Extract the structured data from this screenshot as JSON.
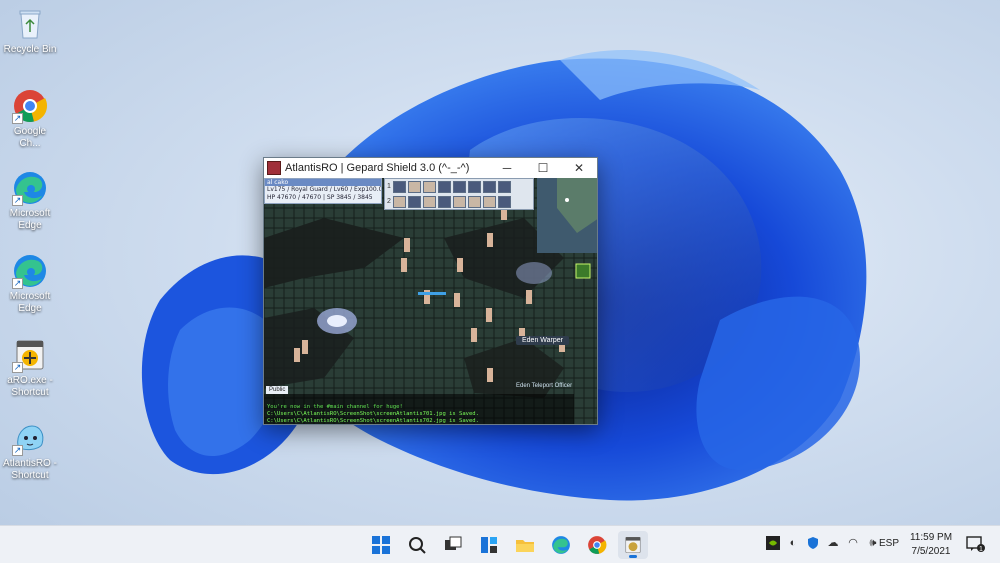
{
  "desktop": {
    "icons": [
      {
        "label": "Recycle Bin",
        "icon": "recycle-bin-icon"
      },
      {
        "label": "Google Ch...",
        "icon": "chrome-icon"
      },
      {
        "label": "Microsoft Edge",
        "icon": "edge-icon"
      },
      {
        "label": "Microsoft Edge",
        "icon": "edge-icon"
      },
      {
        "label": "aRO.exe - Shortcut",
        "icon": "game-exe-icon"
      },
      {
        "label": "AtlantisRO - Shortcut",
        "icon": "atlantisro-icon"
      }
    ]
  },
  "game_window": {
    "title": "AtlantisRO | Gepard Shield 3.0 (^-_-^)",
    "char": {
      "name": "al cako",
      "line1": "Lv175 / Royal Guard / Lv60 / Exp100.0%",
      "line2": "HP 47670 / 47670 | SP 3845 / 3845"
    },
    "hotkey_rows": [
      "1",
      "2"
    ],
    "npc_label": "Eden Warper",
    "npc_label2": "Eden Teleport Officer",
    "chat": {
      "tab": "Public",
      "lines": [
        "You're now in the #main channel for huge!",
        "C:\\Users\\C\\AtlantisRO\\ScreenShot\\screenAtlantis701.jpg is Saved.",
        "C:\\Users\\C\\AtlantisRO\\ScreenShot\\screenAtlantis702.jpg is Saved."
      ]
    }
  },
  "taskbar": {
    "apps": [
      "start-icon",
      "search-icon",
      "task-view-icon",
      "widgets-icon",
      "file-explorer-icon",
      "edge-icon",
      "chrome-icon",
      "game-app-icon"
    ],
    "language": "ESP",
    "time": "11:59 PM",
    "date": "7/5/2021"
  },
  "colors": {
    "wallpaper_blue": "#1f5fe0",
    "taskbar": "#eef1f6",
    "accent": "#1a73d8"
  }
}
